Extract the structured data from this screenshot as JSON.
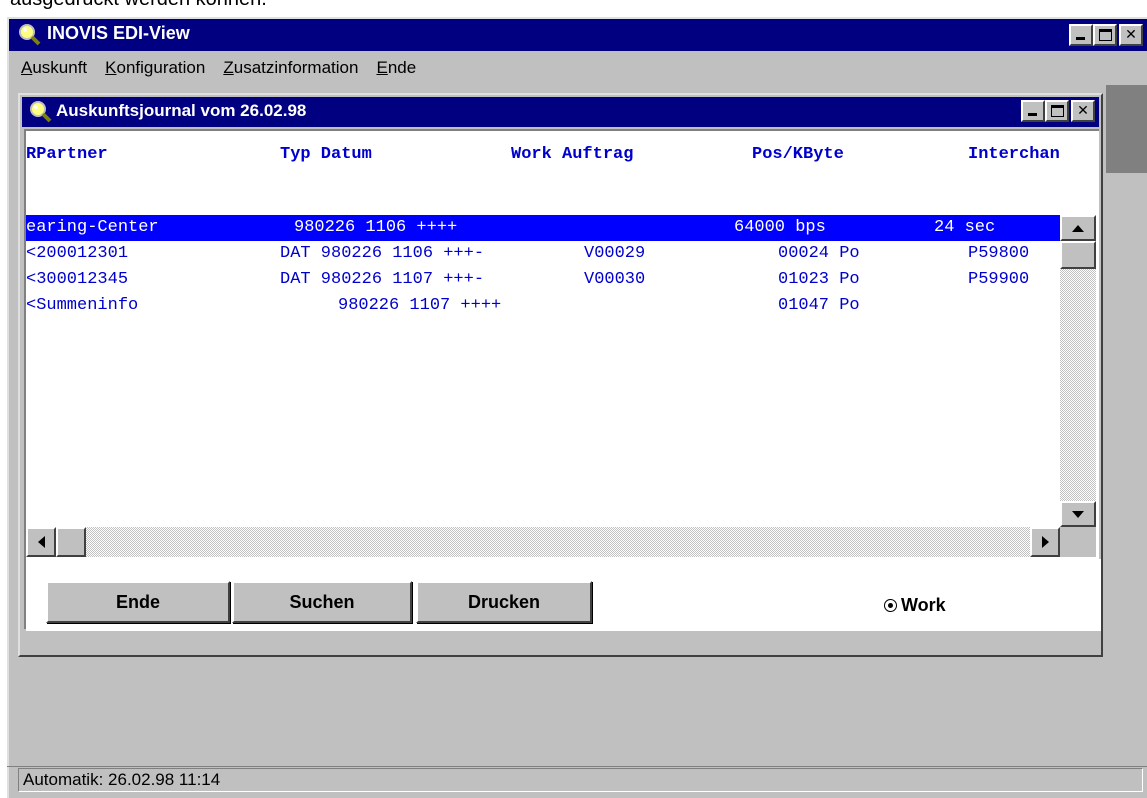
{
  "document_snippet": "ausgedruckt werden können.",
  "app": {
    "title": "INOVIS EDI-View",
    "icon": "magnifier-icon"
  },
  "menu": [
    {
      "label": "Auskunft",
      "accel": "A",
      "rest": "uskunft"
    },
    {
      "label": "Konfiguration",
      "accel": "K",
      "rest": "onfiguration"
    },
    {
      "label": "Zusatzinformation",
      "accel": "Z",
      "rest": "usatzinformation"
    },
    {
      "label": "Ende",
      "accel": "E",
      "rest": "nde"
    }
  ],
  "journal": {
    "title": "Auskunftsjournal vom 26.02.98",
    "headers": {
      "partner": "RPartner",
      "typ_datum": "Typ Datum",
      "work_auftrag": "Work Auftrag",
      "pos_kbyte": "Pos/KByte",
      "interchange": "Interchan"
    },
    "rows": [
      {
        "selected": true,
        "c1": "earing-Center",
        "c2": "980226 1106 ++++",
        "c3": "",
        "c4": "64000 bps",
        "c5": "24 sec"
      },
      {
        "selected": false,
        "c1": "<200012301",
        "c2": "DAT 980226 1106 +++-",
        "c3": "V00029",
        "c4": "00024 Po",
        "c5": "P59800"
      },
      {
        "selected": false,
        "c1": "<300012345",
        "c2": "DAT 980226 1107 +++-",
        "c3": "V00030",
        "c4": "01023 Po",
        "c5": "P59900"
      },
      {
        "selected": false,
        "c1": "<Summeninfo",
        "c2": "980226 1107 ++++",
        "c3": "",
        "c4": "01047 Po",
        "c5": ""
      }
    ]
  },
  "buttons": {
    "ende": "Ende",
    "suchen": "Suchen",
    "drucken": "Drucken"
  },
  "radio": {
    "label": "Work",
    "checked": true
  },
  "status": {
    "text": "Automatik: 26.02.98 11:14"
  },
  "colors": {
    "titlebar": "#000080",
    "list_text": "#0000cc",
    "selection": "#0000ff",
    "face": "#c0c0c0"
  }
}
